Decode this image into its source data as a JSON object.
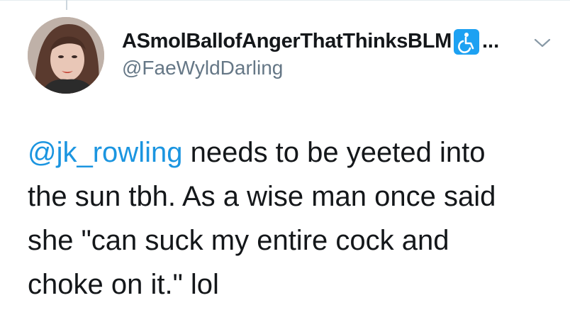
{
  "colors": {
    "text": "#14171a",
    "secondary": "#657786",
    "link": "#1b95e0",
    "badge": "#1da1f2",
    "divider": "#e6ecf0"
  },
  "tweet": {
    "author": {
      "display_name": "ASmolBallofAngerThatThinksBLM",
      "badge_icon": "accessibility-icon",
      "truncation": "...",
      "handle": "@FaeWyldDarling",
      "avatar_icon": "avatar-photo"
    },
    "menu_icon": "chevron-down-icon",
    "body": {
      "mention": "@jk_rowling",
      "line1_rest": " needs to be yeeted into",
      "line2": "the sun tbh. As a wise man once said",
      "line3": "she \"can suck my entire cock and",
      "line4": "choke on it.\" lol"
    }
  }
}
